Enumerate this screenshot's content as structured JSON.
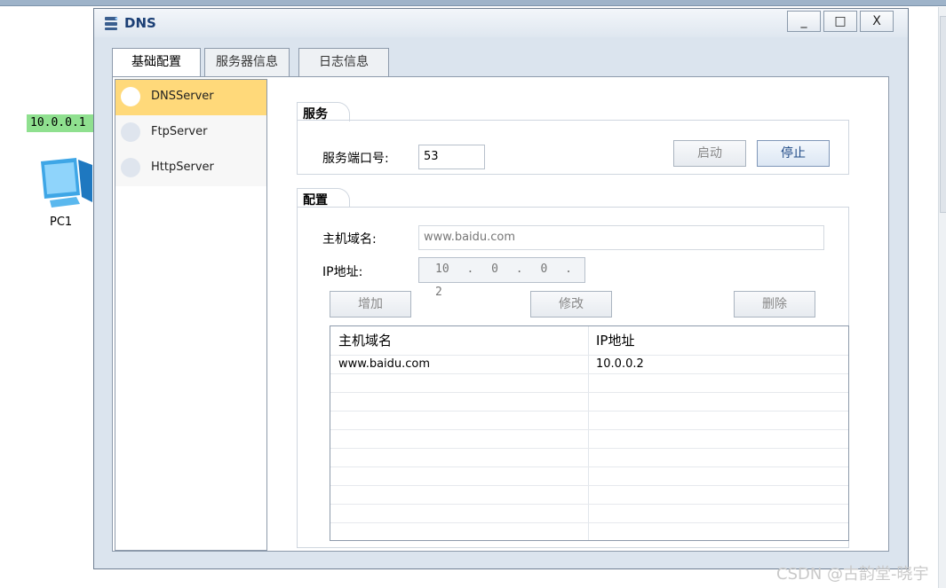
{
  "desktop": {
    "ip_label": "10.0.0.1",
    "pc_label": "PC1",
    "watermark": "CSDN @古韵堂-晓宇"
  },
  "window": {
    "title": "DNS",
    "controls": {
      "minimize": "_",
      "maximize": "□",
      "close": "X"
    }
  },
  "tabs": [
    {
      "label": "基础配置",
      "active": true
    },
    {
      "label": "服务器信息",
      "active": false
    },
    {
      "label": "日志信息",
      "active": false
    }
  ],
  "servers": [
    {
      "label": "DNSServer",
      "selected": true
    },
    {
      "label": "FtpServer",
      "selected": false
    },
    {
      "label": "HttpServer",
      "selected": false
    }
  ],
  "service": {
    "group_label": "服务",
    "port_label": "服务端口号:",
    "port_value": "53",
    "start_label": "启动",
    "stop_label": "停止"
  },
  "config": {
    "group_label": "配置",
    "host_label": "主机域名:",
    "host_placeholder": "www.baidu.com",
    "ip_label": "IP地址:",
    "ip_octets": [
      "10",
      "0",
      "0",
      "2"
    ],
    "add_label": "增加",
    "modify_label": "修改",
    "delete_label": "删除"
  },
  "table": {
    "headers": [
      "主机域名",
      "IP地址"
    ],
    "rows": [
      [
        "www.baidu.com",
        "10.0.0.2"
      ]
    ]
  },
  "colors": {
    "selected_server": "#ffd97a",
    "ip_label_bg": "#8fe08f"
  }
}
